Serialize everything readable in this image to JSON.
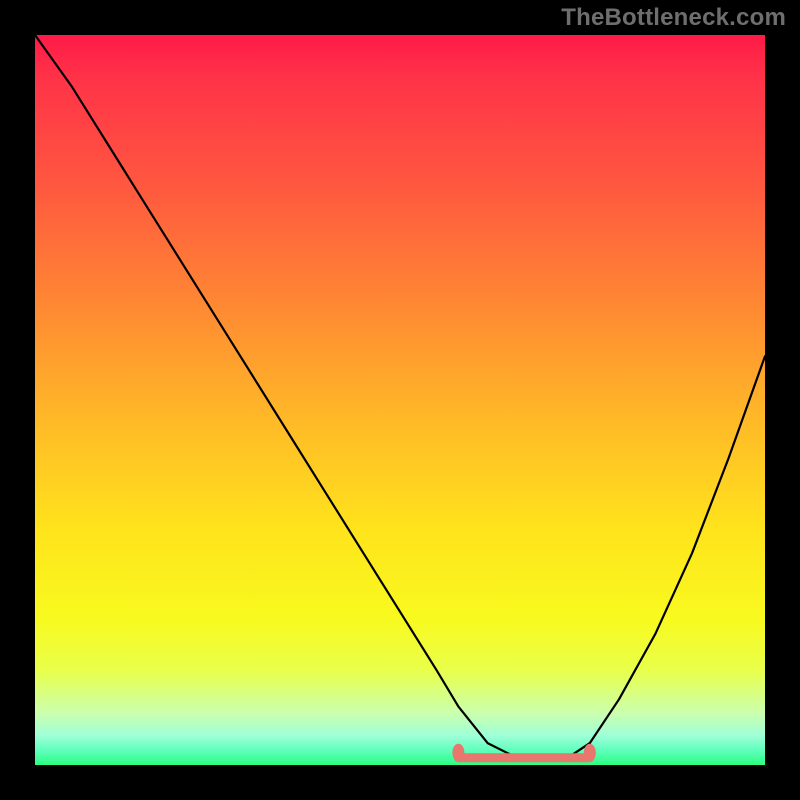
{
  "watermark": "TheBottleneck.com",
  "colors": {
    "frame_bg": "#000000",
    "curve": "#000000",
    "sweet_spot": "#e8776e",
    "gradient_top": "#ff1a48",
    "gradient_bottom": "#2aff80"
  },
  "chart_data": {
    "type": "line",
    "title": "",
    "xlabel": "",
    "ylabel": "",
    "xlim": [
      0,
      100
    ],
    "ylim": [
      0,
      100
    ],
    "grid": false,
    "legend": false,
    "notes": "Background is a vertical red→yellow→green gradient (top = high bottleneck, bottom = none). Black V-shaped curve shows bottleneck %. A coral highlight marks the sweet-spot range along the x-axis where bottleneck is ~0.",
    "series": [
      {
        "name": "bottleneck-curve",
        "x": [
          0,
          5,
          10,
          15,
          20,
          25,
          30,
          35,
          40,
          45,
          50,
          55,
          58,
          62,
          66,
          70,
          73,
          76,
          80,
          85,
          90,
          95,
          100
        ],
        "y": [
          100,
          93,
          85,
          77,
          69,
          61,
          53,
          45,
          37,
          29,
          21,
          13,
          8,
          3,
          1,
          1,
          1,
          3,
          9,
          18,
          29,
          42,
          56
        ]
      }
    ],
    "sweet_spot": {
      "x_start": 58,
      "x_end": 76,
      "y": 1
    }
  }
}
